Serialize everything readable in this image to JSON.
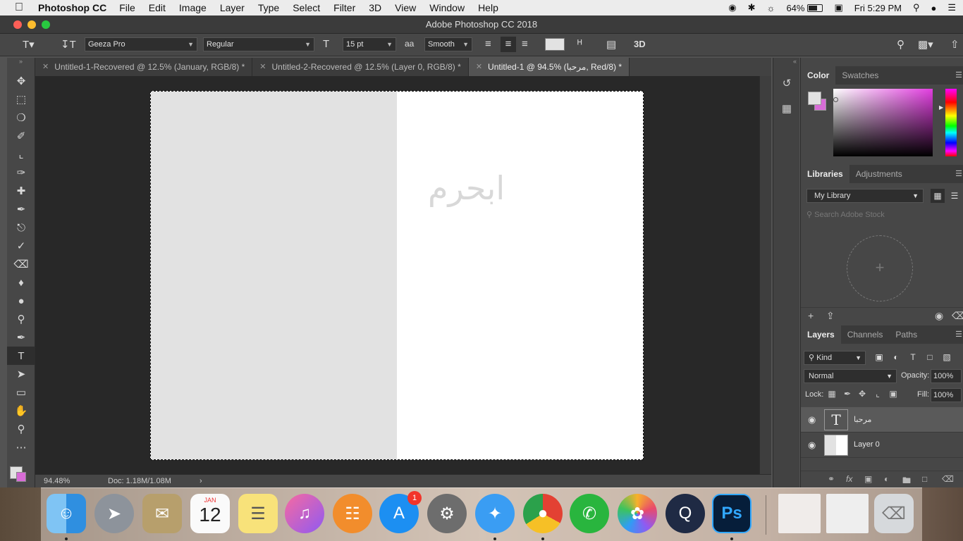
{
  "menubar": {
    "app_name": "Photoshop CC",
    "items": [
      "File",
      "Edit",
      "Image",
      "Layer",
      "Type",
      "Select",
      "Filter",
      "3D",
      "View",
      "Window",
      "Help"
    ],
    "battery": "64%",
    "clock": "Fri 5:29 PM"
  },
  "window": {
    "title": "Adobe Photoshop CC 2018"
  },
  "options": {
    "font_family": "Geeza Pro",
    "font_style": "Regular",
    "font_size": "15 pt",
    "antialias": "Smooth",
    "icon_3d": "3D"
  },
  "tabs": [
    {
      "label": "Untitled-1-Recovered @ 12.5% (January, RGB/8) *",
      "active": false
    },
    {
      "label": "Untitled-2-Recovered @ 12.5% (Layer 0, RGB/8) *",
      "active": false
    },
    {
      "label": "Untitled-1 @ 94.5% (مرحبا, Red/8) *",
      "active": true
    }
  ],
  "canvas": {
    "text": "ابحرم"
  },
  "status": {
    "zoom": "94.48%",
    "doc": "Doc: 1.18M/1.08M"
  },
  "color_panel": {
    "tabs": [
      "Color",
      "Swatches"
    ],
    "foreground": "#e2e2e2",
    "background": "#d86cd7"
  },
  "libraries_panel": {
    "tabs": [
      "Libraries",
      "Adjustments"
    ],
    "library": "My Library",
    "search_placeholder": "Search Adobe Stock"
  },
  "layers_panel": {
    "tabs": [
      "Layers",
      "Channels",
      "Paths"
    ],
    "kind": "Kind",
    "blend_mode": "Normal",
    "opacity_label": "Opacity:",
    "opacity": "100%",
    "lock_label": "Lock:",
    "fill_label": "Fill:",
    "fill": "100%",
    "layers": [
      {
        "name": "مرحبا",
        "type": "text",
        "selected": true
      },
      {
        "name": "Layer 0",
        "type": "image",
        "selected": false
      }
    ]
  },
  "dock": {
    "calendar_month": "JAN",
    "calendar_day": "12",
    "appstore_badge": "1",
    "photoshop_label": "Ps"
  }
}
